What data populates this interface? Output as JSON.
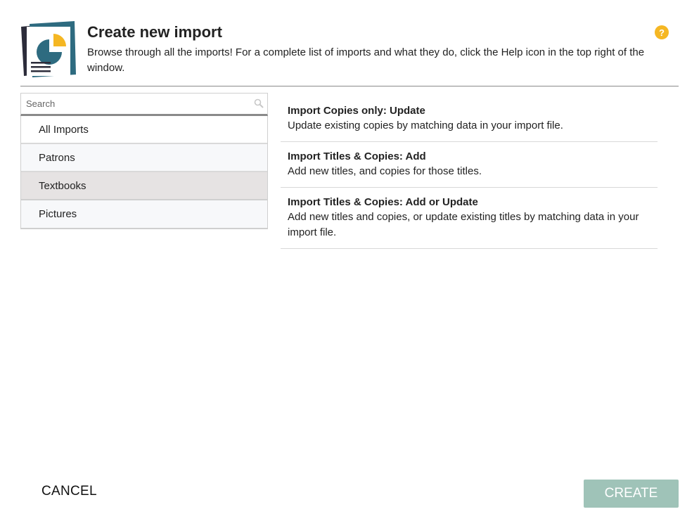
{
  "header": {
    "title": "Create new import",
    "subtitle": "Browse through all the imports! For a complete list of imports and what they do, click the Help icon in the top right of the window.",
    "help_icon": "question-mark-icon",
    "help_label": "?"
  },
  "search": {
    "placeholder": "Search",
    "value": ""
  },
  "categories": [
    {
      "label": "All Imports",
      "selected": false
    },
    {
      "label": "Patrons",
      "selected": false
    },
    {
      "label": "Textbooks",
      "selected": true
    },
    {
      "label": "Pictures",
      "selected": false
    }
  ],
  "imports": [
    {
      "title": "Import Copies only: Update",
      "description": "Update existing copies by matching data in your import file."
    },
    {
      "title": "Import Titles & Copies: Add",
      "description": "Add new titles, and copies for those titles."
    },
    {
      "title": "Import Titles & Copies: Add or Update",
      "description": "Add new titles and copies, or update existing titles by matching data in your import file."
    }
  ],
  "footer": {
    "cancel_label": "CANCEL",
    "create_label": "CREATE"
  },
  "colors": {
    "accent_help": "#f5b723",
    "create_button": "#9fc3b8",
    "selected_row": "#e6e3e3",
    "icon_teal": "#2e6b80",
    "icon_yellow": "#f5b723",
    "icon_dark": "#2c2c3a"
  }
}
